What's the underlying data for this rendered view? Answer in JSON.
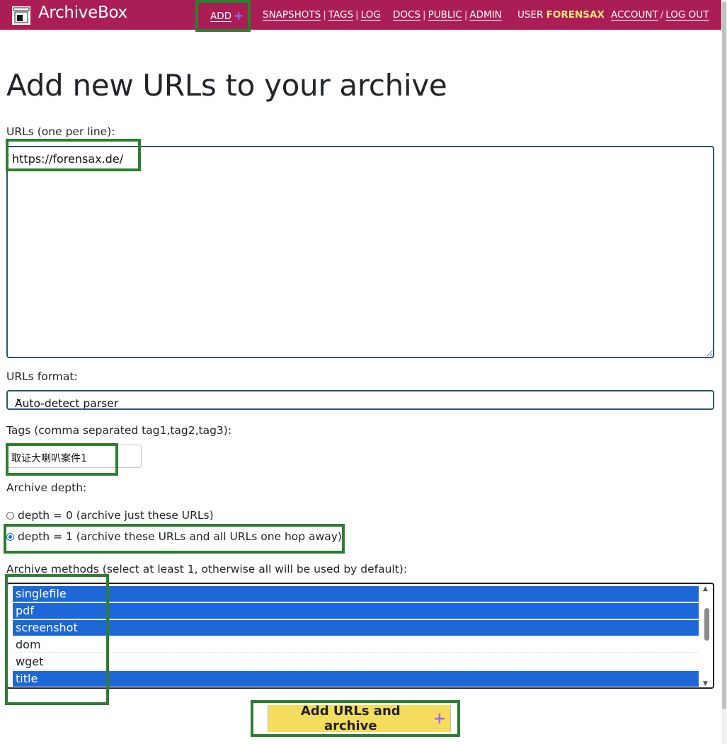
{
  "header": {
    "brand": "ArchiveBox",
    "nav": {
      "add": "ADD",
      "snapshots": "SNAPSHOTS",
      "tags": "TAGS",
      "log": "LOG",
      "docs": "DOCS",
      "public": "PUBLIC",
      "admin": "ADMIN",
      "user_label": "USER",
      "user_name": "FORENSAX",
      "account": "ACCOUNT",
      "logout": "LOG OUT",
      "sep": "|",
      "slash": "/"
    },
    "colors": {
      "bar": "#aa1e55",
      "plus": "#9a6bff",
      "username": "#ffe680"
    }
  },
  "page": {
    "title": "Add new URLs to your archive",
    "urls_label": "URLs (one per line):",
    "urls_value": "https://forensax.de/",
    "format_label": "URLs format:",
    "format_value": "Auto-detect parser",
    "tags_label": "Tags (comma separated tag1,tag2,tag3):",
    "tags_value": "取证大喇叭案件1",
    "depth_label": "Archive depth:",
    "depth_options": [
      {
        "label": "depth = 0 (archive just these URLs)",
        "checked": false
      },
      {
        "label": "depth = 1 (archive these URLs and all URLs one hop away)",
        "checked": true
      }
    ],
    "methods_label": "Archive methods (select at least 1, otherwise all will be used by default):",
    "methods": [
      {
        "label": "singlefile",
        "selected": true
      },
      {
        "label": "pdf",
        "selected": true
      },
      {
        "label": "screenshot",
        "selected": true
      },
      {
        "label": "dom",
        "selected": false
      },
      {
        "label": "wget",
        "selected": false
      },
      {
        "label": "title",
        "selected": true
      }
    ],
    "submit_label": "Add URLs and archive",
    "colors": {
      "selected": "#1e67d6",
      "submit": "#f3dc5e",
      "highlight_box": "#2e7d32"
    }
  }
}
